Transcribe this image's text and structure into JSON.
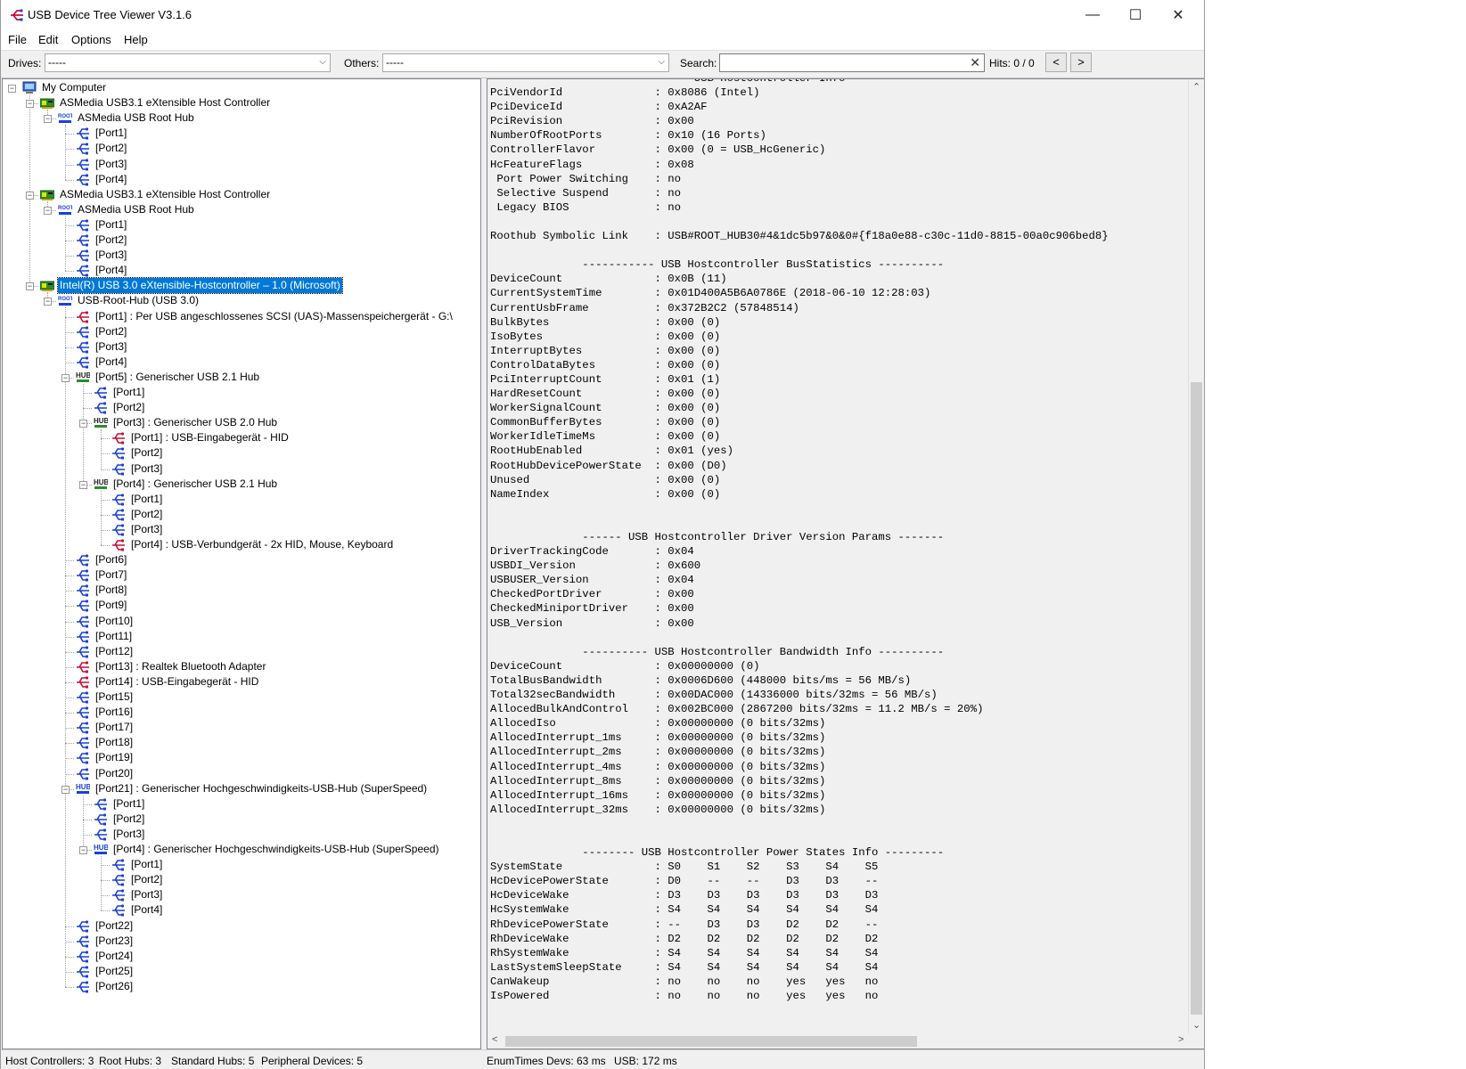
{
  "window": {
    "title": "USB Device Tree Viewer V3.1.6",
    "minimize": "—",
    "maximize": "☐",
    "close": "✕"
  },
  "menu": [
    "File",
    "Edit",
    "Options",
    "Help"
  ],
  "toolbar": {
    "drives_label": "Drives:",
    "drives_value": "-----",
    "others_label": "Others:",
    "others_value": "-----",
    "search_label": "Search:",
    "search_value": "",
    "hits": "Hits: 0 / 0",
    "prev": "<",
    "next": ">"
  },
  "tree": [
    {
      "level": 0,
      "icon": "computer-icon",
      "label": "My Computer",
      "expanded": true
    },
    {
      "level": 1,
      "icon": "host-controller-icon",
      "label": "ASMedia USB3.1 eXtensible Host Controller",
      "expanded": true
    },
    {
      "level": 2,
      "icon": "root-hub-icon",
      "label": "ASMedia USB Root Hub",
      "expanded": true
    },
    {
      "level": 3,
      "icon": "usb-port-icon",
      "label": "[Port1]"
    },
    {
      "level": 3,
      "icon": "usb-port-icon",
      "label": "[Port2]"
    },
    {
      "level": 3,
      "icon": "usb-port-icon",
      "label": "[Port3]"
    },
    {
      "level": 3,
      "icon": "usb-port-icon",
      "label": "[Port4]"
    },
    {
      "level": 1,
      "icon": "host-controller-icon",
      "label": "ASMedia USB3.1 eXtensible Host Controller",
      "expanded": true
    },
    {
      "level": 2,
      "icon": "root-hub-icon",
      "label": "ASMedia USB Root Hub",
      "expanded": true
    },
    {
      "level": 3,
      "icon": "usb-port-icon",
      "label": "[Port1]"
    },
    {
      "level": 3,
      "icon": "usb-port-icon",
      "label": "[Port2]"
    },
    {
      "level": 3,
      "icon": "usb-port-icon",
      "label": "[Port3]"
    },
    {
      "level": 3,
      "icon": "usb-port-icon",
      "label": "[Port4]"
    },
    {
      "level": 1,
      "icon": "host-controller-icon",
      "label": "Intel(R) USB 3.0 eXtensible-Hostcontroller – 1.0 (Microsoft)",
      "expanded": true,
      "selected": true
    },
    {
      "level": 2,
      "icon": "root-hub-icon",
      "label": "USB-Root-Hub (USB 3.0)",
      "expanded": true
    },
    {
      "level": 3,
      "icon": "usb-device-icon",
      "label": "[Port1] : Per USB angeschlossenes SCSI (UAS)-Massenspeichergerät - G:\\"
    },
    {
      "level": 3,
      "icon": "usb-port-icon",
      "label": "[Port2]"
    },
    {
      "level": 3,
      "icon": "usb-port-icon",
      "label": "[Port3]"
    },
    {
      "level": 3,
      "icon": "usb-port-icon",
      "label": "[Port4]"
    },
    {
      "level": 3,
      "icon": "hub-icon",
      "label": "[Port5] : Generischer USB 2.1 Hub",
      "expanded": true
    },
    {
      "level": 4,
      "icon": "usb-port-icon",
      "label": "[Port1]"
    },
    {
      "level": 4,
      "icon": "usb-port-icon",
      "label": "[Port2]"
    },
    {
      "level": 4,
      "icon": "hub-icon",
      "label": "[Port3] : Generischer USB 2.0 Hub",
      "expanded": true
    },
    {
      "level": 5,
      "icon": "usb-device-icon",
      "label": "[Port1] : USB-Eingabegerät - HID"
    },
    {
      "level": 5,
      "icon": "usb-port-icon",
      "label": "[Port2]"
    },
    {
      "level": 5,
      "icon": "usb-port-icon",
      "label": "[Port3]"
    },
    {
      "level": 4,
      "icon": "hub-icon",
      "label": "[Port4] : Generischer USB 2.1 Hub",
      "expanded": true
    },
    {
      "level": 5,
      "icon": "usb-port-icon",
      "label": "[Port1]"
    },
    {
      "level": 5,
      "icon": "usb-port-icon",
      "label": "[Port2]"
    },
    {
      "level": 5,
      "icon": "usb-port-icon",
      "label": "[Port3]"
    },
    {
      "level": 5,
      "icon": "usb-device-icon",
      "label": "[Port4] : USB-Verbundgerät - 2x HID, Mouse, Keyboard"
    },
    {
      "level": 3,
      "icon": "usb-port-icon",
      "label": "[Port6]"
    },
    {
      "level": 3,
      "icon": "usb-port-icon",
      "label": "[Port7]"
    },
    {
      "level": 3,
      "icon": "usb-port-icon",
      "label": "[Port8]"
    },
    {
      "level": 3,
      "icon": "usb-port-icon",
      "label": "[Port9]"
    },
    {
      "level": 3,
      "icon": "usb-port-icon",
      "label": "[Port10]"
    },
    {
      "level": 3,
      "icon": "usb-port-icon",
      "label": "[Port11]"
    },
    {
      "level": 3,
      "icon": "usb-port-icon",
      "label": "[Port12]"
    },
    {
      "level": 3,
      "icon": "usb-device-icon",
      "label": "[Port13] : Realtek Bluetooth Adapter"
    },
    {
      "level": 3,
      "icon": "usb-device-icon",
      "label": "[Port14] : USB-Eingabegerät - HID"
    },
    {
      "level": 3,
      "icon": "usb-port-icon",
      "label": "[Port15]"
    },
    {
      "level": 3,
      "icon": "usb-port-icon",
      "label": "[Port16]"
    },
    {
      "level": 3,
      "icon": "usb-port-icon",
      "label": "[Port17]"
    },
    {
      "level": 3,
      "icon": "usb-port-icon",
      "label": "[Port18]"
    },
    {
      "level": 3,
      "icon": "usb-port-icon",
      "label": "[Port19]"
    },
    {
      "level": 3,
      "icon": "usb-port-icon",
      "label": "[Port20]"
    },
    {
      "level": 3,
      "icon": "hub-ss-icon",
      "label": "[Port21] : Generischer Hochgeschwindigkeits-USB-Hub (SuperSpeed)",
      "expanded": true
    },
    {
      "level": 4,
      "icon": "usb-port-icon",
      "label": "[Port1]"
    },
    {
      "level": 4,
      "icon": "usb-port-icon",
      "label": "[Port2]"
    },
    {
      "level": 4,
      "icon": "usb-port-icon",
      "label": "[Port3]"
    },
    {
      "level": 4,
      "icon": "hub-ss-icon",
      "label": "[Port4] : Generischer Hochgeschwindigkeits-USB-Hub (SuperSpeed)",
      "expanded": true
    },
    {
      "level": 5,
      "icon": "usb-port-icon",
      "label": "[Port1]"
    },
    {
      "level": 5,
      "icon": "usb-port-icon",
      "label": "[Port2]"
    },
    {
      "level": 5,
      "icon": "usb-port-icon",
      "label": "[Port3]"
    },
    {
      "level": 5,
      "icon": "usb-port-icon",
      "label": "[Port4]"
    },
    {
      "level": 3,
      "icon": "usb-port-icon",
      "label": "[Port22]"
    },
    {
      "level": 3,
      "icon": "usb-port-icon",
      "label": "[Port23]"
    },
    {
      "level": 3,
      "icon": "usb-port-icon",
      "label": "[Port24]"
    },
    {
      "level": 3,
      "icon": "usb-port-icon",
      "label": "[Port25]"
    },
    {
      "level": 3,
      "icon": "usb-port-icon",
      "label": "[Port26]"
    }
  ],
  "info_text": "              ---------------- USB Hostcontroller Info ---------------\nPciVendorId              : 0x8086 (Intel)\nPciDeviceId              : 0xA2AF\nPciRevision              : 0x00\nNumberOfRootPorts        : 0x10 (16 Ports)\nControllerFlavor         : 0x00 (0 = USB_HcGeneric)\nHcFeatureFlags           : 0x08\n Port Power Switching    : no\n Selective Suspend       : no\n Legacy BIOS             : no\n\nRoothub Symbolic Link    : USB#ROOT_HUB30#4&1dc5b97&0&0#{f18a0e88-c30c-11d0-8815-00a0c906bed8}\n\n              ----------- USB Hostcontroller BusStatistics ----------\nDeviceCount              : 0x0B (11)\nCurrentSystemTime        : 0x01D400A5B6A0786E (2018-06-10 12:28:03)\nCurrentUsbFrame          : 0x372B2C2 (57848514)\nBulkBytes                : 0x00 (0)\nIsoBytes                 : 0x00 (0)\nInterruptBytes           : 0x00 (0)\nControlDataBytes         : 0x00 (0)\nPciInterruptCount        : 0x01 (1)\nHardResetCount           : 0x00 (0)\nWorkerSignalCount        : 0x00 (0)\nCommonBufferBytes        : 0x00 (0)\nWorkerIdleTimeMs         : 0x00 (0)\nRootHubEnabled           : 0x01 (yes)\nRootHubDevicePowerState  : 0x00 (D0)\nUnused                   : 0x00 (0)\nNameIndex                : 0x00 (0)\n\n\n              ------ USB Hostcontroller Driver Version Params -------\nDriverTrackingCode       : 0x04\nUSBDI_Version            : 0x600\nUSBUSER_Version          : 0x04\nCheckedPortDriver        : 0x00\nCheckedMiniportDriver    : 0x00\nUSB_Version              : 0x00\n\n              ---------- USB Hostcontroller Bandwidth Info ----------\nDeviceCount              : 0x00000000 (0)\nTotalBusBandwidth        : 0x0006D600 (448000 bits/ms = 56 MB/s)\nTotal32secBandwidth      : 0x00DAC000 (14336000 bits/32ms = 56 MB/s)\nAllocedBulkAndControl    : 0x002BC000 (2867200 bits/32ms = 11.2 MB/s = 20%)\nAllocedIso               : 0x00000000 (0 bits/32ms)\nAllocedInterrupt_1ms     : 0x00000000 (0 bits/32ms)\nAllocedInterrupt_2ms     : 0x00000000 (0 bits/32ms)\nAllocedInterrupt_4ms     : 0x00000000 (0 bits/32ms)\nAllocedInterrupt_8ms     : 0x00000000 (0 bits/32ms)\nAllocedInterrupt_16ms    : 0x00000000 (0 bits/32ms)\nAllocedInterrupt_32ms    : 0x00000000 (0 bits/32ms)\n\n\n              -------- USB Hostcontroller Power States Info ---------\nSystemState              : S0    S1    S2    S3    S4    S5\nHcDevicePowerState       : D0    --    --    D3    D3    --\nHcDeviceWake             : D3    D3    D3    D3    D3    D3\nHcSystemWake             : S4    S4    S4    S4    S4    S4\nRhDevicePowerState       : --    D3    D3    D2    D2    --\nRhDeviceWake             : D2    D2    D2    D2    D2    D2\nRhSystemWake             : S4    S4    S4    S4    S4    S4\nLastSystemSleepState     : S4    S4    S4    S4    S4    S4\nCanWakeup                : no    no    no    yes   yes   no\nIsPowered                : no    no    no    yes   yes   no",
  "status": {
    "host_controllers": "Host Controllers: 3",
    "root_hubs": "Root Hubs: 3",
    "standard_hubs": "Standard Hubs: 5",
    "peripheral_devices": "Peripheral Devices: 5",
    "enum_times": "EnumTimes",
    "devs": "Devs: 63 ms",
    "usb": "USB: 172 ms"
  },
  "colors": {
    "selection": "#0078d7",
    "usb_icon": "#1a3fd6",
    "device_icon": "#c0103a",
    "controller_icon": "#2e8b2e"
  }
}
